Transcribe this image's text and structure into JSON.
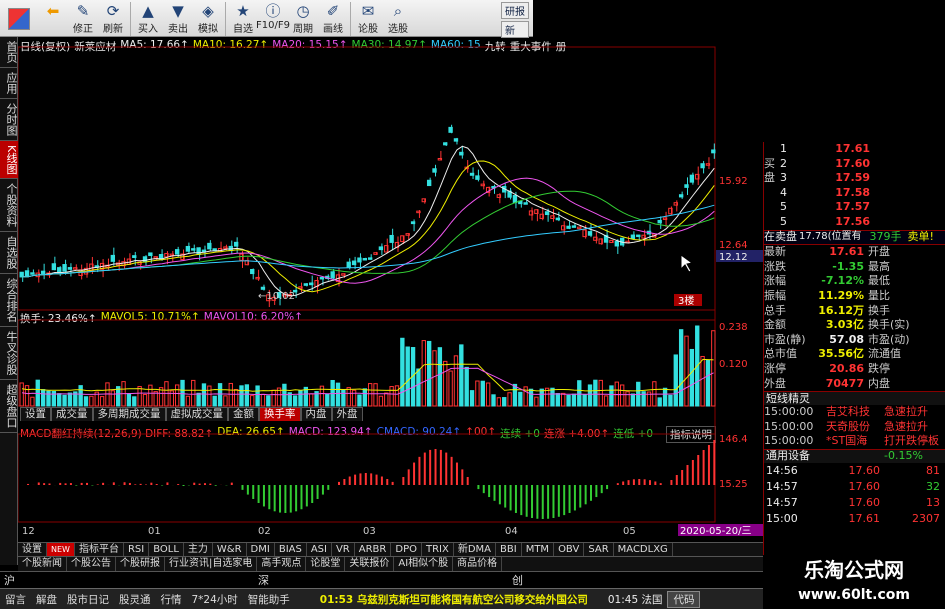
{
  "toolbar": {
    "buttons": [
      {
        "label": "修正",
        "icon": "wrench-icon",
        "glyph": "✎"
      },
      {
        "label": "刷新",
        "icon": "refresh-icon",
        "glyph": "⟳"
      },
      {
        "label": "买入",
        "icon": "buy-icon",
        "glyph": "▲"
      },
      {
        "label": "卖出",
        "icon": "sell-icon",
        "glyph": "▼"
      },
      {
        "label": "模拟",
        "icon": "simulate-icon",
        "glyph": "◈"
      },
      {
        "label": "自选",
        "icon": "favorite-icon",
        "glyph": "★"
      },
      {
        "label": "F10/F9",
        "icon": "info-icon",
        "glyph": "ⓘ"
      },
      {
        "label": "周期",
        "icon": "clock-icon",
        "glyph": "◷"
      },
      {
        "label": "画线",
        "icon": "pen-icon",
        "glyph": "✐"
      },
      {
        "label": "论股",
        "icon": "chat-icon",
        "glyph": "✉"
      },
      {
        "label": "选股",
        "icon": "filter-icon",
        "glyph": "⌕"
      }
    ],
    "right": [
      "研报",
      "新"
    ]
  },
  "left_tabs": [
    "首页",
    "应用",
    "分时图",
    "K线图",
    "个股资料",
    "自选股",
    "综合排名",
    "牛叉诊股",
    "超级盘口"
  ],
  "kline": {
    "header": [
      {
        "text": "日线(复权)",
        "color": "#eee"
      },
      {
        "text": "新莱应材",
        "color": "#eee"
      },
      {
        "text": "MA5: 17.66↑",
        "color": "#eee"
      },
      {
        "text": "MA10: 16.27↑",
        "color": "#ee0"
      },
      {
        "text": "MA20: 15.15↑",
        "color": "#e5e"
      },
      {
        "text": "MA30: 14.97↑",
        "color": "#3c3"
      },
      {
        "text": "MA60: 15",
        "color": "#3cf"
      },
      {
        "text": "九转",
        "color": "#eee"
      },
      {
        "text": "重大事件",
        "color": "#eee"
      },
      {
        "text": "册",
        "color": "#eee"
      }
    ],
    "price_labels": [
      "15.92",
      "12.64",
      "12.12"
    ],
    "low_label": "←10.02",
    "marker": "3楼"
  },
  "volume": {
    "header": [
      {
        "text": "换手: 23.46%↑",
        "color": "#eee"
      },
      {
        "text": "MAVOL5: 10.71%↑",
        "color": "#ee0"
      },
      {
        "text": "MAVOL10: 6.20%↑",
        "color": "#e5e"
      }
    ],
    "labels": [
      "0.238",
      "0.120"
    ]
  },
  "subtabs": [
    "设置",
    "成交量",
    "多周期成交量",
    "虚拟成交量",
    "金额",
    "换手率",
    "内盘",
    "外盘"
  ],
  "subtab_active": "换手率",
  "macd": {
    "header": [
      {
        "text": "MACD翻红持续(12,26,9) DIFF: 88.82↑",
        "color": "#f33"
      },
      {
        "text": "DEA: 26.65↑",
        "color": "#ee0"
      },
      {
        "text": "MACD: 123.94↑",
        "color": "#e5e"
      },
      {
        "text": "CMACD: 90.24↑",
        "color": "#36f"
      },
      {
        "text": "↑00↑",
        "color": "#f33"
      },
      {
        "text": "连续 +0",
        "color": "#3c3"
      },
      {
        "text": "连涨 +4.00↑",
        "color": "#f33"
      },
      {
        "text": "连低 +0",
        "color": "#3c3"
      }
    ],
    "explain": "指标说明",
    "labels": [
      "146.4",
      "15.25"
    ]
  },
  "date_axis": [
    "12",
    "01",
    "02",
    "03",
    "04",
    "05"
  ],
  "date_current": "2020-05-20/三",
  "bottom_tabs": [
    "设置",
    "NEW",
    "指标平台",
    "RSI",
    "BOLL",
    "主力",
    "W&R",
    "DMI",
    "BIAS",
    "ASI",
    "VR",
    "ARBR",
    "DPO",
    "TRIX",
    "新DMA",
    "BBI",
    "MTM",
    "OBV",
    "SAR",
    "MACDLXG"
  ],
  "news_tabs": [
    "个股新闻",
    "个股公告",
    "个股研报",
    "行业资讯|自选家电",
    "高手观点",
    "论股堂",
    "关联报价",
    "AI相似个股",
    "商品价格"
  ],
  "index_bar": [
    "沪",
    "深",
    "创"
  ],
  "status": {
    "items": [
      "留言",
      "解盘",
      "股市日记",
      "股灵通",
      "行情",
      "7*24小时",
      "智能助手"
    ],
    "news": "01:53 乌兹别克斯坦可能将国有航空公司移交给外国公司",
    "time": "01:45 法国",
    "tag": "代码"
  },
  "orderbook": {
    "buy_label": "买盘",
    "buys": [
      {
        "n": "1",
        "price": "17.61"
      },
      {
        "n": "2",
        "price": "17.60"
      },
      {
        "n": "3",
        "price": "17.59"
      },
      {
        "n": "4",
        "price": "17.58"
      },
      {
        "n": "5",
        "price": "17.57"
      },
      {
        "n": "5",
        "price": "17.56"
      }
    ],
    "pending": {
      "label": "在卖盘",
      "price": "17.78(位置有",
      "qty": "379手",
      "action": "卖单!"
    }
  },
  "quote": [
    {
      "l": "最新",
      "v": "17.61",
      "c": "red",
      "r": "开盘"
    },
    {
      "l": "涨跌",
      "v": "-1.35",
      "c": "grn",
      "r": "最高"
    },
    {
      "l": "涨幅",
      "v": "-7.12%",
      "c": "grn",
      "r": "最低"
    },
    {
      "l": "振幅",
      "v": "11.29%",
      "c": "yel",
      "r": "量比"
    },
    {
      "l": "总手",
      "v": "16.12万",
      "c": "yel",
      "r": "换手"
    },
    {
      "l": "金额",
      "v": "3.03亿",
      "c": "yel",
      "r": "换手(实)"
    },
    {
      "l": "市盈(静)",
      "v": "57.08",
      "c": "wht",
      "r": "市盈(动)"
    },
    {
      "l": "总市值",
      "v": "35.56亿",
      "c": "yel",
      "r": "流通值"
    },
    {
      "l": "涨停",
      "v": "20.86",
      "c": "red",
      "r": "跌停"
    },
    {
      "l": "外盘",
      "v": "70477",
      "c": "red",
      "r": "内盘"
    }
  ],
  "sprite": {
    "title": "短线精灵",
    "rows": [
      {
        "t": "15:00:00",
        "n": "吉艾科技",
        "e": "急速拉升"
      },
      {
        "t": "15:00:00",
        "n": "天奇股份",
        "e": "急速拉升"
      },
      {
        "t": "15:00:00",
        "n": "*ST国海",
        "e": "打开跌停板"
      }
    ]
  },
  "industry": {
    "label": "通用设备",
    "value": "-0.15%"
  },
  "ticks": [
    {
      "t": "14:56",
      "p": "17.60",
      "q": "81"
    },
    {
      "t": "14:57",
      "p": "17.60",
      "q": "32"
    },
    {
      "t": "14:57",
      "p": "17.60",
      "q": "13"
    },
    {
      "t": "15:00",
      "p": "17.61",
      "q": "2307"
    }
  ],
  "watermark": {
    "line1": "乐淘公式网",
    "line2": "www.60lt.com"
  },
  "colors": {
    "up": "#ff3333",
    "down": "#33e0e0",
    "accent": "#b00000"
  }
}
